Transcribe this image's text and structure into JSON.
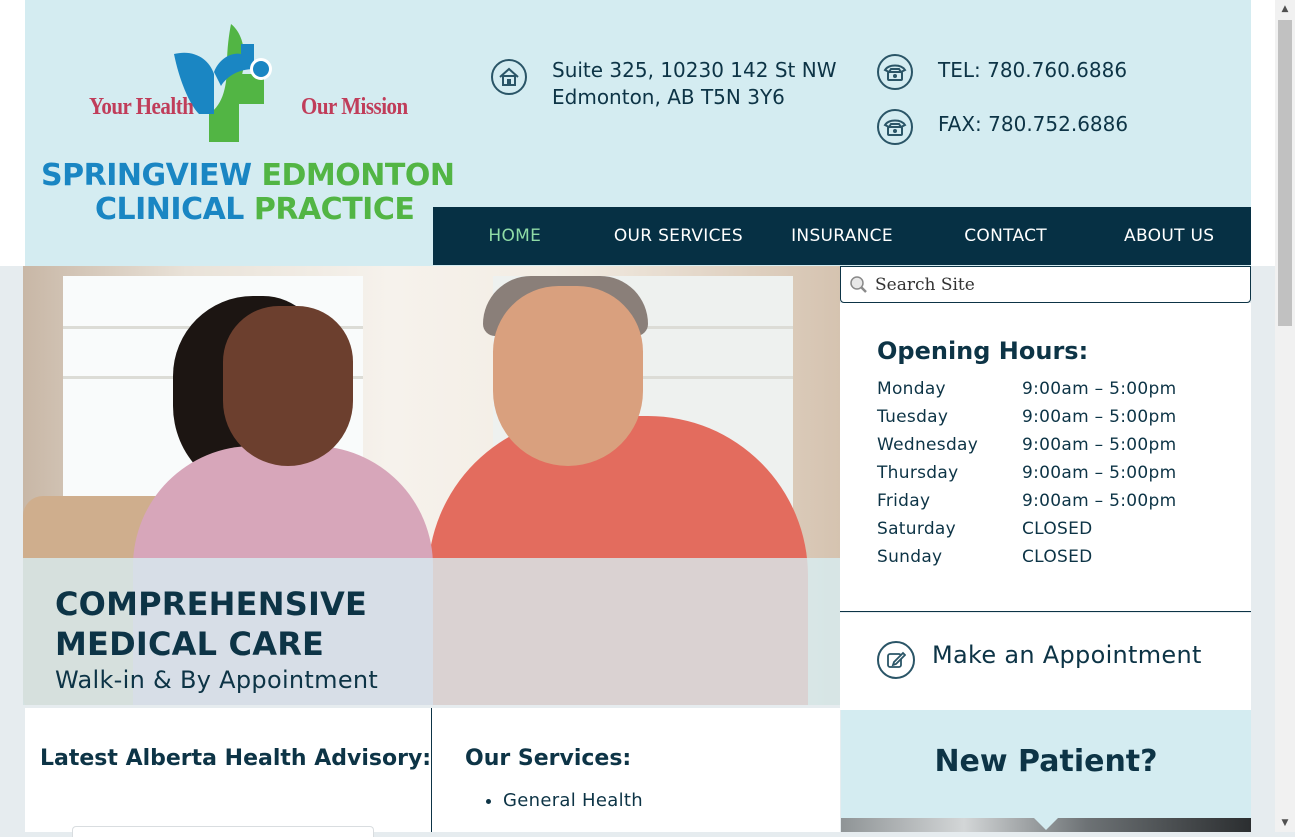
{
  "logo": {
    "tag_left": "Your Health",
    "tag_right": "Our Mission",
    "line1_a": "SPRINGVIEW",
    "line1_b": "EDMONTON",
    "line2_a": "CLINICAL",
    "line2_b": "PRACTICE",
    "icon": "health-cross-person-icon"
  },
  "contact": {
    "address_line1": "Suite 325, 10230 142 St NW",
    "address_line2": "Edmonton, AB T5N 3Y6",
    "tel": "TEL: 780.760.6886",
    "fax": "FAX: 780.752.6886",
    "address_icon": "home-icon",
    "phone_icon": "telephone-icon"
  },
  "nav": {
    "items": [
      "HOME",
      "OUR SERVICES",
      "INSURANCE",
      "CONTACT",
      "ABOUT US"
    ],
    "active": "HOME"
  },
  "hero": {
    "headline_line1": "COMPREHENSIVE",
    "headline_line2": "MEDICAL CARE",
    "subline": "Walk-in & By Appointment"
  },
  "search": {
    "placeholder": "Search Site",
    "icon": "magnifier-icon"
  },
  "hours": {
    "title": "Opening Hours:",
    "rows": [
      {
        "day": "Monday",
        "time": "9:00am – 5:00pm"
      },
      {
        "day": "Tuesday",
        "time": "9:00am – 5:00pm"
      },
      {
        "day": "Wednesday",
        "time": "9:00am – 5:00pm"
      },
      {
        "day": "Thursday",
        "time": "9:00am – 5:00pm"
      },
      {
        "day": "Friday",
        "time": "9:00am – 5:00pm"
      },
      {
        "day": "Saturday",
        "time": "CLOSED"
      },
      {
        "day": "Sunday",
        "time": "CLOSED"
      }
    ]
  },
  "appointment": {
    "label": "Make an Appointment",
    "icon": "edit-icon"
  },
  "advisory": {
    "title": "Latest Alberta Health Advisory:"
  },
  "services": {
    "title": "Our Services:",
    "items": [
      "General Health"
    ]
  },
  "new_patient": {
    "title": "New Patient?"
  },
  "colors": {
    "header_bg": "#d4ecf1",
    "nav_bg": "#063044",
    "nav_active": "#8fdba6",
    "text_dark": "#0d3446",
    "brand_blue": "#1a86c3",
    "brand_green": "#52b544",
    "brand_red": "#c03d5a"
  }
}
